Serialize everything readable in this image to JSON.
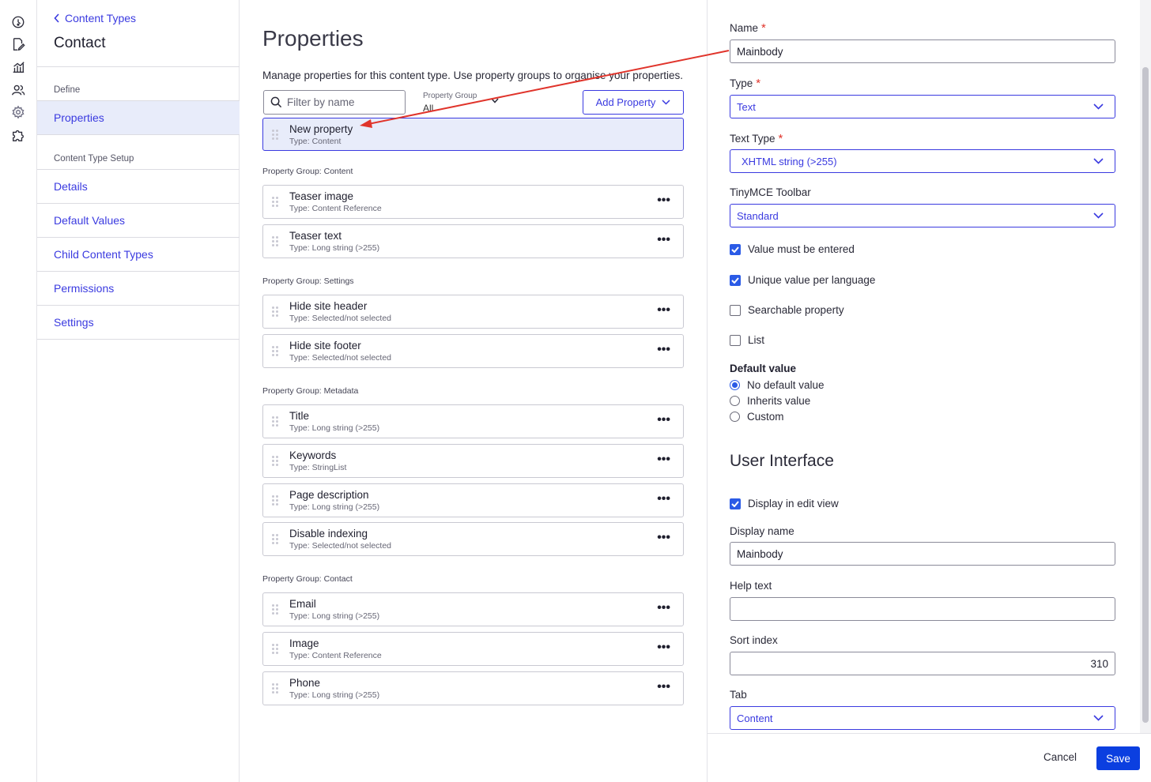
{
  "nav": {
    "back_label": "Content Types",
    "title": "Contact",
    "section_define": "Define",
    "section_setup": "Content Type Setup",
    "items": [
      {
        "label": "Properties"
      },
      {
        "label": "Details"
      },
      {
        "label": "Default Values"
      },
      {
        "label": "Child Content Types"
      },
      {
        "label": "Permissions"
      },
      {
        "label": "Settings"
      }
    ]
  },
  "rail_icons": [
    "dashboard-icon",
    "edit-content-icon",
    "analytics-icon",
    "users-icon",
    "settings-icon",
    "addons-icon"
  ],
  "main": {
    "title": "Properties",
    "description": "Manage properties for this content type. Use property groups to organise your properties.",
    "filter_placeholder": "Filter by name",
    "group_filter_label": "Property Group",
    "group_filter_value": "All",
    "add_button": "Add Property",
    "selected_property": {
      "name": "New property",
      "type": "Type: Content"
    },
    "groups": [
      {
        "label": "Property Group: Content",
        "props": [
          {
            "name": "Teaser image",
            "type": "Type: Content Reference"
          },
          {
            "name": "Teaser text",
            "type": "Type: Long string (>255)"
          }
        ]
      },
      {
        "label": "Property Group: Settings",
        "props": [
          {
            "name": "Hide site header",
            "type": "Type: Selected/not selected"
          },
          {
            "name": "Hide site footer",
            "type": "Type: Selected/not selected"
          }
        ]
      },
      {
        "label": "Property Group: Metadata",
        "props": [
          {
            "name": "Title",
            "type": "Type: Long string (>255)"
          },
          {
            "name": "Keywords",
            "type": "Type: StringList"
          },
          {
            "name": "Page description",
            "type": "Type: Long string (>255)"
          },
          {
            "name": "Disable indexing",
            "type": "Type: Selected/not selected"
          }
        ]
      },
      {
        "label": "Property Group: Contact",
        "props": [
          {
            "name": "Email",
            "type": "Type: Long string (>255)"
          },
          {
            "name": "Image",
            "type": "Type: Content Reference"
          },
          {
            "name": "Phone",
            "type": "Type: Long string (>255)"
          }
        ]
      }
    ],
    "more_glyph": "•••"
  },
  "panel": {
    "name_label": "Name",
    "name_value": "Mainbody",
    "type_label": "Type",
    "type_value": "Text",
    "text_type_label": "Text Type",
    "text_type_value": "XHTML string (>255)",
    "toolbar_label": "TinyMCE Toolbar",
    "toolbar_value": "Standard",
    "required_mark": "*",
    "checkboxes": [
      {
        "label": "Value must be entered",
        "checked": true
      },
      {
        "label": "Unique value per language",
        "checked": true
      },
      {
        "label": "Searchable property",
        "checked": false
      },
      {
        "label": "List",
        "checked": false
      }
    ],
    "default_value_heading": "Default value",
    "default_options": [
      {
        "label": "No default value",
        "selected": true
      },
      {
        "label": "Inherits value",
        "selected": false
      },
      {
        "label": "Custom",
        "selected": false
      }
    ],
    "ui_heading": "User Interface",
    "display_in_edit": "Display in edit view",
    "display_name_label": "Display name",
    "display_name_value": "Mainbody",
    "help_text_label": "Help text",
    "help_text_value": "",
    "sort_index_label": "Sort index",
    "sort_index_value": "310",
    "tab_label": "Tab",
    "tab_value": "Content",
    "cancel": "Cancel",
    "save": "Save"
  },
  "colors": {
    "accent": "#3a3ae0",
    "save": "#0b3fe0",
    "annotation_arrow": "#e0342b",
    "selected_bg": "#e8ecfa"
  }
}
